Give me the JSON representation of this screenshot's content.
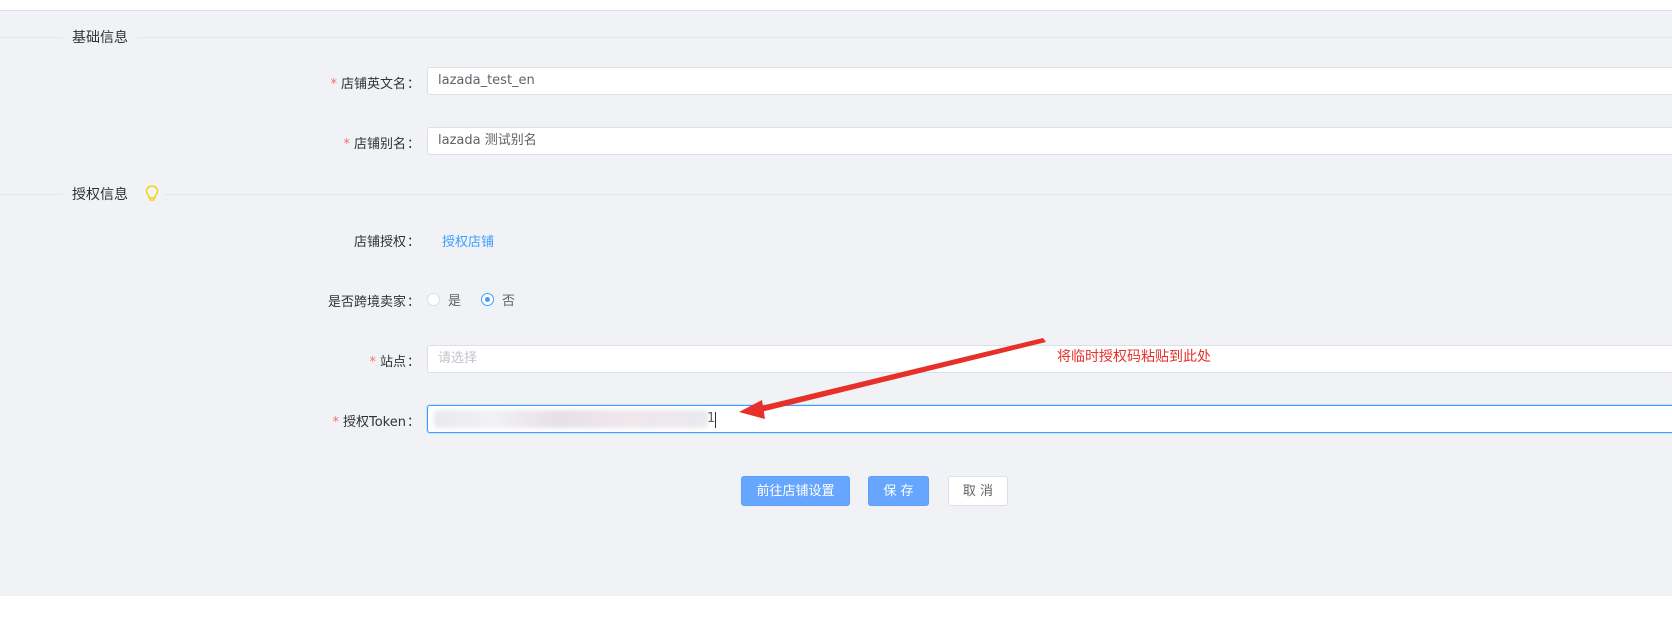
{
  "sections": {
    "basic": "基础信息",
    "auth": "授权信息"
  },
  "fields": {
    "shop_en_name": {
      "label": "店铺英文名",
      "value": "lazada_test_en"
    },
    "shop_alias": {
      "label": "店铺别名",
      "value": "lazada 测试别名"
    },
    "shop_auth": {
      "label": "店铺授权",
      "link": "授权店铺"
    },
    "cross_border": {
      "label": "是否跨境卖家",
      "options": [
        "是",
        "否"
      ],
      "selected": "否"
    },
    "site": {
      "label": "站点",
      "placeholder": "请选择"
    },
    "token": {
      "label": "授权Token",
      "visible_tail": "1"
    }
  },
  "colon": "：",
  "required_mark": "*",
  "buttons": {
    "goto_settings": "前往店铺设置",
    "save": "保 存",
    "cancel": "取 消"
  },
  "annotation": "将临时授权码粘贴到此处",
  "icons": {
    "hint": "lightbulb-icon"
  },
  "colors": {
    "primary": "#409eff",
    "button": "#66a6ff",
    "required": "#f56c6c",
    "annotation": "#e7302a",
    "hint": "#f5d314"
  }
}
